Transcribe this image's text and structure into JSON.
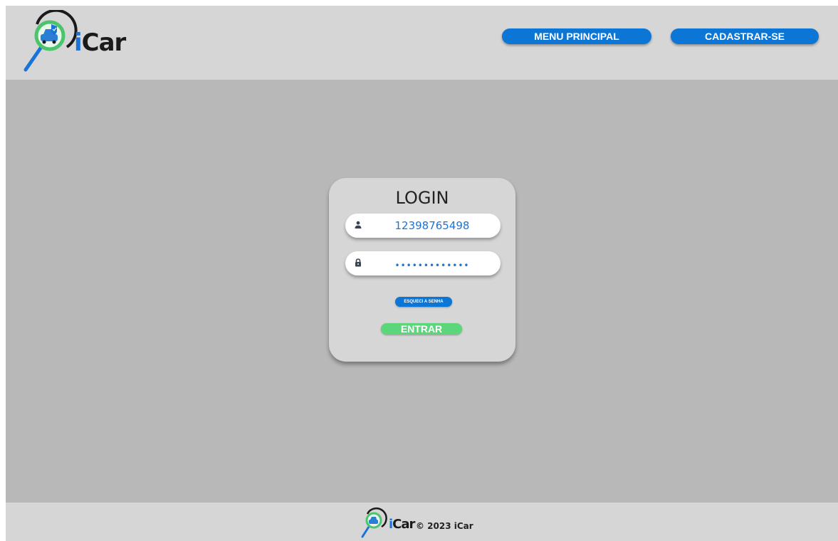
{
  "header": {
    "brand": {
      "i": "i",
      "rest": "Car"
    },
    "nav": {
      "menu_label": "MENU PRINCIPAL",
      "register_label": "CADASTRAR-SE"
    }
  },
  "login": {
    "title": "LOGIN",
    "username_value": "12398765498",
    "password_masked": "•••••••••••••",
    "forgot_label": "ESQUECI A SENHA",
    "enter_label": "ENTRAR"
  },
  "footer": {
    "brand": {
      "i": "i",
      "rest": "Car"
    },
    "copyright": "© 2023 iCar"
  },
  "colors": {
    "accent_blue": "#0b76d6",
    "enter_green": "#5cd67a",
    "header_bg": "#d6d6d6",
    "main_bg": "#b9b8b8"
  },
  "icons": {
    "logo": "magnifier-car-shield-icon",
    "user": "user-icon",
    "lock": "lock-icon"
  }
}
